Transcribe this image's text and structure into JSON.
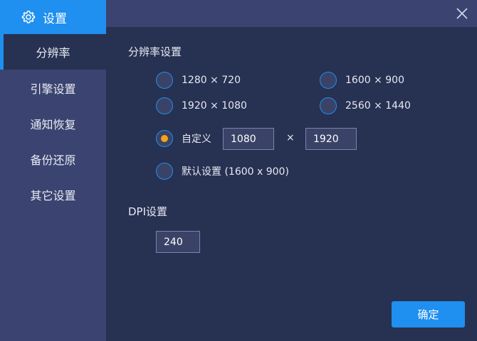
{
  "window": {
    "title": "设置",
    "icons": {
      "header": "gear-icon",
      "close": "close-icon"
    }
  },
  "sidebar": {
    "items": [
      {
        "label": "分辨率",
        "active": true
      },
      {
        "label": "引擎设置",
        "active": false
      },
      {
        "label": "通知恢复",
        "active": false
      },
      {
        "label": "备份还原",
        "active": false
      },
      {
        "label": "其它设置",
        "active": false
      }
    ]
  },
  "resolution": {
    "section_title": "分辨率设置",
    "options": [
      {
        "label": "1280 × 720",
        "checked": false
      },
      {
        "label": "1600 × 900",
        "checked": false
      },
      {
        "label": "1920 × 1080",
        "checked": false
      },
      {
        "label": "2560 × 1440",
        "checked": false
      }
    ],
    "custom": {
      "label": "自定义",
      "checked": true,
      "width": "1080",
      "times": "×",
      "height": "1920"
    },
    "default_option": {
      "label": "默认设置 (1600 x 900)",
      "checked": false
    }
  },
  "dpi": {
    "section_title": "DPI设置",
    "value": "240"
  },
  "footer": {
    "confirm_label": "确定"
  },
  "colors": {
    "accent": "#1f8ff0",
    "background": "#273152",
    "sidebar": "#3b4470",
    "radio_selected": "#f5a316"
  }
}
